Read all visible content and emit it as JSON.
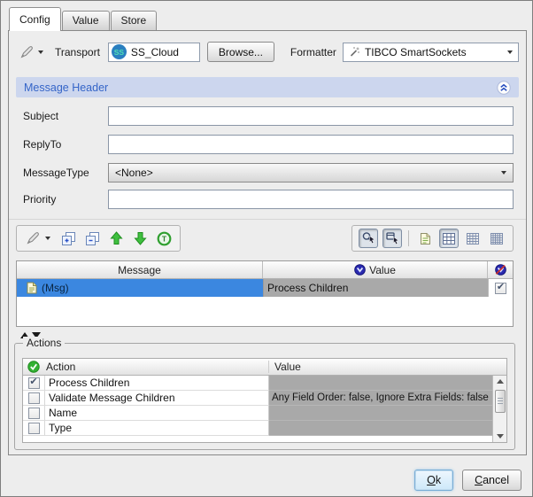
{
  "tabs": {
    "config": "Config",
    "value": "Value",
    "store": "Store"
  },
  "transport": {
    "label": "Transport",
    "badge": "SS",
    "value": "SS_Cloud",
    "browse": "Browse..."
  },
  "formatter": {
    "label": "Formatter",
    "value": "TIBCO SmartSockets"
  },
  "header": {
    "title": "Message Header"
  },
  "fields": {
    "subject": "Subject",
    "replyto": "ReplyTo",
    "messagetype": "MessageType",
    "messagetype_value": "<None>",
    "priority": "Priority"
  },
  "message_table": {
    "col_message": "Message",
    "col_value": "Value",
    "row": {
      "name": "(Msg)",
      "value": "Process Children",
      "checked": true,
      "selected": true
    }
  },
  "actions": {
    "title": "Actions",
    "col_action": "Action",
    "col_value": "Value",
    "rows": [
      {
        "checked": true,
        "action": "Process Children",
        "value": ""
      },
      {
        "checked": false,
        "action": "Validate Message Children",
        "value": "Any Field Order: false, Ignore Extra Fields: false"
      },
      {
        "checked": false,
        "action": "Name",
        "value": ""
      },
      {
        "checked": false,
        "action": "Type",
        "value": ""
      }
    ]
  },
  "buttons": {
    "ok_m": "O",
    "ok_rest": "k",
    "cancel_m": "C",
    "cancel_rest": "ancel"
  },
  "colors": {
    "header_bar": "#ccd6ee",
    "header_text": "#3565c8",
    "selection_blue": "#3b87e0",
    "value_cell_gray": "#a9a9a9",
    "ok_button": "#cde8f9",
    "badge_blue": "#2a7fc0",
    "badge_text": "#4fe0b2"
  },
  "icons": {
    "pencil": "set-value-pencil",
    "wand": "formatter-wand",
    "collapse": "double-chevron-up-circle",
    "copy_plus": "duplicate-plus",
    "copy_minus": "duplicate-minus",
    "up": "green-up-arrow",
    "down": "green-down-arrow",
    "reset": "green-T-circle",
    "zoom_select": "magnifier-cursor",
    "zoom_deselect": "magnifier-cursor-alt",
    "document": "page",
    "grid": "table-grid",
    "value_circle": "blue-V-circle",
    "no_value_circle": "blue-V-circle-slashed",
    "action_check": "green-check-circle"
  }
}
